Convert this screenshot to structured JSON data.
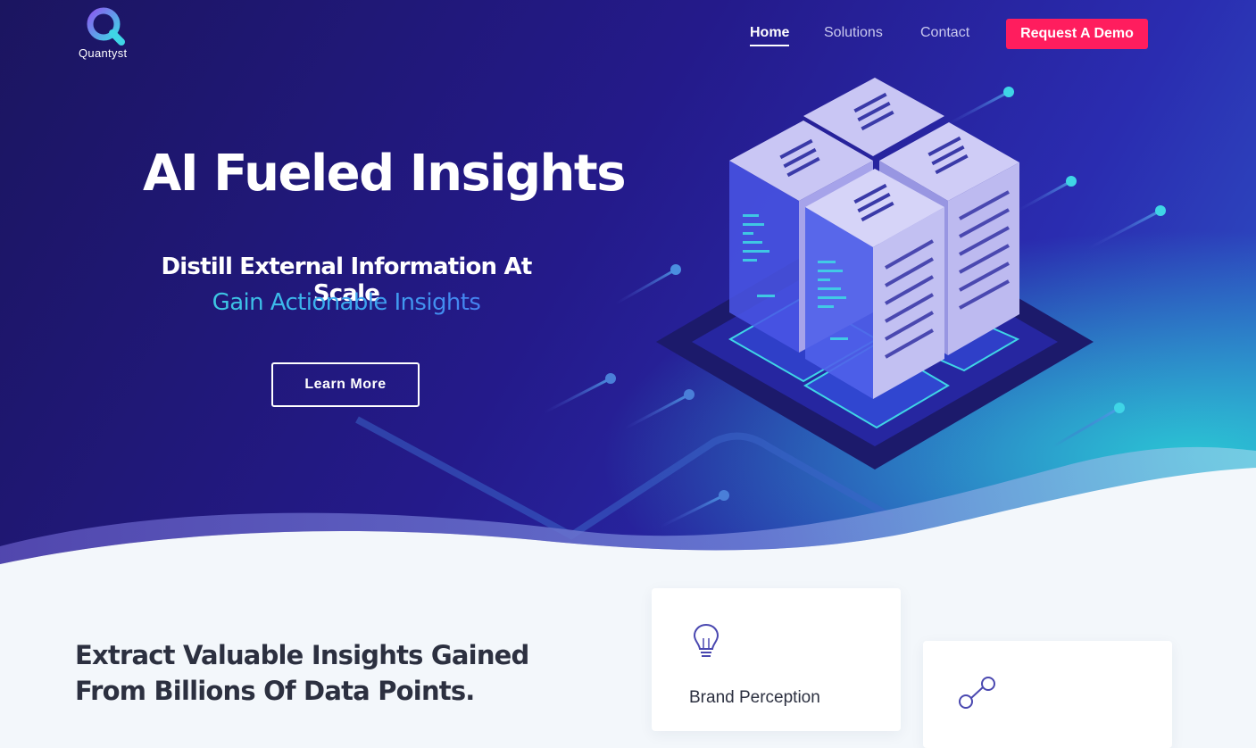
{
  "brand": {
    "name": "Quantyst"
  },
  "nav": {
    "home": "Home",
    "solutions": "Solutions",
    "contact": "Contact",
    "cta": "Request A Demo"
  },
  "hero": {
    "title": "AI Fueled Insights",
    "subtitle_line1": "Distill External Information At Scale",
    "subtitle_line2": "Gain Actionable Insights",
    "button": "Learn More"
  },
  "section": {
    "heading": "Extract Valuable Insights Gained From Billions Of Data Points."
  },
  "cards": [
    {
      "title": "Brand Perception",
      "icon": "lightbulb-icon"
    },
    {
      "title": "",
      "icon": "network-nodes-icon"
    }
  ],
  "colors": {
    "hero_dark": "#1b1560",
    "hero_mid": "#241a8a",
    "accent_cta": "#ff1d5e",
    "accent_cyan": "#3fd5d9",
    "section_bg": "#f3f7fb",
    "heading_text": "#2c3040"
  }
}
